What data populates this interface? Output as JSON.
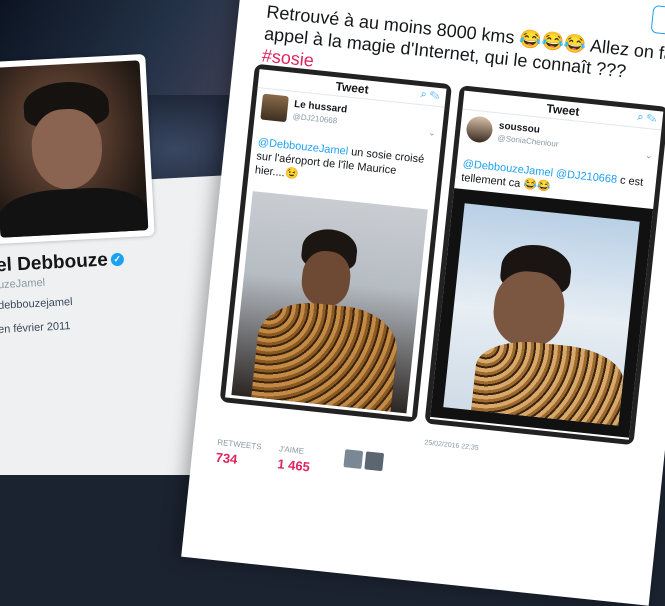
{
  "profile": {
    "name": "el Debbouze",
    "handle": "uzeJamel",
    "link": "debbouzejamel",
    "joined": "en février 2011"
  },
  "tweet": {
    "text": "Retrouvé à au moins 8000 kms 😂😂😂 Allez on fait appel à la magie d'Internet, qui le connaît ???",
    "hashtag": "#sosie",
    "follow_icon": "person-add-icon"
  },
  "embedded": [
    {
      "header": "Tweet",
      "name": "Le hussard",
      "handle": "@DJ210668",
      "mention": "@DebbouzeJamel",
      "text": " un sosie croisé sur l'aéroport de l'île Maurice hier....😉"
    },
    {
      "header": "Tweet",
      "name": "soussou",
      "handle": "@SoniaCheniour",
      "mention": "@DebbouzeJamel @DJ210668",
      "text": " c est tellement ca 😂😂"
    }
  ],
  "stats": {
    "retweets_label": "RETWEETS",
    "retweets_value": "734",
    "likes_label": "J'AIME",
    "likes_value": "1 465"
  },
  "mini_date": "25/02/2016 22:35",
  "colors": {
    "link": "#1da1f2",
    "hashtag": "#e0245e",
    "stat": "#e0245e"
  }
}
